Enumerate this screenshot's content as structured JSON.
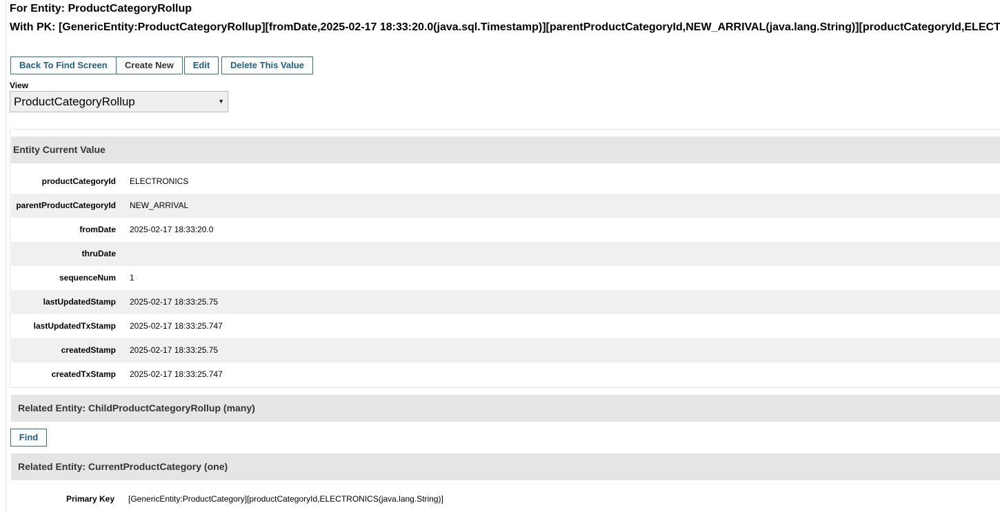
{
  "header": {
    "entity_title": "For Entity: ProductCategoryRollup",
    "pk_title": "With PK: [GenericEntity:ProductCategoryRollup][fromDate,2025-02-17 18:33:20.0(java.sql.Timestamp)][parentProductCategoryId,NEW_ARRIVAL(java.lang.String)][productCategoryId,ELECTRONICS(java.lang.String)]"
  },
  "toolbar": {
    "back_label": "Back To Find Screen",
    "create_label": "Create New",
    "edit_label": "Edit",
    "delete_label": "Delete This Value"
  },
  "view": {
    "label": "View",
    "selected": "ProductCategoryRollup"
  },
  "current_value": {
    "title": "Entity Current Value",
    "fields": [
      {
        "name": "productCategoryId",
        "value": "ELECTRONICS"
      },
      {
        "name": "parentProductCategoryId",
        "value": "NEW_ARRIVAL"
      },
      {
        "name": "fromDate",
        "value": "2025-02-17 18:33:20.0"
      },
      {
        "name": "thruDate",
        "value": ""
      },
      {
        "name": "sequenceNum",
        "value": "1"
      },
      {
        "name": "lastUpdatedStamp",
        "value": "2025-02-17 18:33:25.75"
      },
      {
        "name": "lastUpdatedTxStamp",
        "value": "2025-02-17 18:33:25.747"
      },
      {
        "name": "createdStamp",
        "value": "2025-02-17 18:33:25.75"
      },
      {
        "name": "createdTxStamp",
        "value": "2025-02-17 18:33:25.747"
      }
    ]
  },
  "related_child": {
    "title": "Related Entity: ChildProductCategoryRollup (many)",
    "find_label": "Find"
  },
  "related_current": {
    "title": "Related Entity: CurrentProductCategory (one)",
    "pk_label": "Primary Key",
    "pk_value": "[GenericEntity:ProductCategory][productCategoryId,ELECTRONICS(java.lang.String)]"
  },
  "colors": {
    "button_text": "#1f5f86",
    "button_border": "#2e6b8f",
    "section_header_bg": "#e5e5e5",
    "alt_row_bg": "#f0f0f0"
  }
}
